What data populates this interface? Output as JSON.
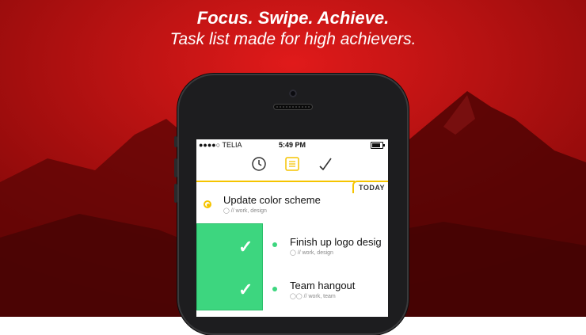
{
  "headline": {
    "line1": "Focus. Swipe. Achieve.",
    "line2": "Task list made for high achievers."
  },
  "status_bar": {
    "carrier": "●●●●○ TELIA",
    "time": "5:49 PM"
  },
  "tabs": [
    {
      "name": "clock-tab",
      "icon": "clock-icon"
    },
    {
      "name": "list-tab",
      "icon": "list-icon",
      "active": true
    },
    {
      "name": "done-tab",
      "icon": "checkmark-icon"
    }
  ],
  "section": {
    "label": "TODAY"
  },
  "tasks": [
    {
      "title": "Update color scheme",
      "meta": "// work, design",
      "status_color": "#f5c400"
    },
    {
      "title": "Finish up logo desig",
      "meta": "// work, design",
      "status_color": "#3dd67f"
    },
    {
      "title": "Team hangout",
      "meta": "// work, team",
      "status_color": "#3dd67f"
    }
  ],
  "colors": {
    "accent": "#f5c400",
    "done": "#3dd67f",
    "background": "#b80c0c"
  }
}
